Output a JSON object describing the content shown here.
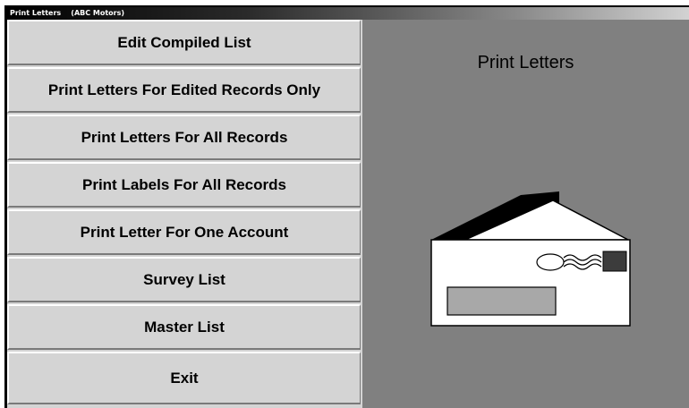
{
  "window": {
    "title": "Print Letters    (ABC Motors)"
  },
  "menu": {
    "items": [
      {
        "label": "Edit Compiled List"
      },
      {
        "label": "Print Letters For Edited Records Only"
      },
      {
        "label": "Print Letters For All Records"
      },
      {
        "label": "Print Labels For All Records"
      },
      {
        "label": "Print Letter For One Account"
      },
      {
        "label": "Survey List"
      },
      {
        "label": "Master List"
      },
      {
        "label": "Exit"
      }
    ]
  },
  "panel": {
    "title": "Print Letters",
    "illustration_icon": "envelope-with-letter-icon"
  },
  "colors": {
    "button_face": "#d4d4d4",
    "panel_background": "#808080",
    "title_gradient_start": "#000000",
    "title_gradient_end": "#d2d2d2"
  }
}
